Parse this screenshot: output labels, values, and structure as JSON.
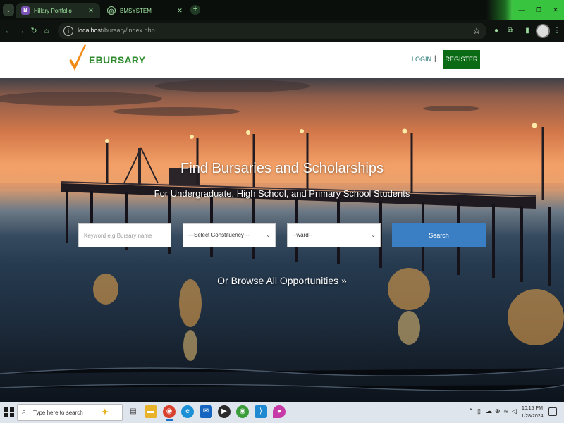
{
  "browser": {
    "tabs": [
      {
        "label": "Hillary Portfolio",
        "favicon": "B",
        "active": true
      },
      {
        "label": "BMSYSTEM",
        "favicon": "globe",
        "active": false
      }
    ],
    "url_host": "localhost",
    "url_path": "/bursary/index.php",
    "accent": "#39c43f"
  },
  "header": {
    "logo_text": "EBURSARY",
    "login_label": "LOGIN",
    "separator": "|",
    "register_label": "REGISTER",
    "brand_color": "#2e8b2e",
    "register_color": "#0a6b14"
  },
  "hero": {
    "title": "Find Bursaries and Scholarships",
    "subtitle": "For Undergraduate, High School, and Primary School Students",
    "keyword_placeholder": "Keyword e.g Bursary name",
    "constituency_selected": "---Select Constituency---",
    "ward_selected": "--ward--",
    "search_label": "Search",
    "search_color": "#3a7fc4",
    "browse_all_label": "Or Browse All Opportunities »"
  },
  "taskbar": {
    "search_placeholder": "Type here to search",
    "apps": [
      "task-view-icon",
      "file-explorer-icon",
      "chrome-icon",
      "edge-icon",
      "mail-icon",
      "media-player-icon",
      "chrome-canary-icon",
      "vscode-icon",
      "color-app-icon"
    ],
    "time": "10:15 PM",
    "date": "1/28/2024"
  }
}
